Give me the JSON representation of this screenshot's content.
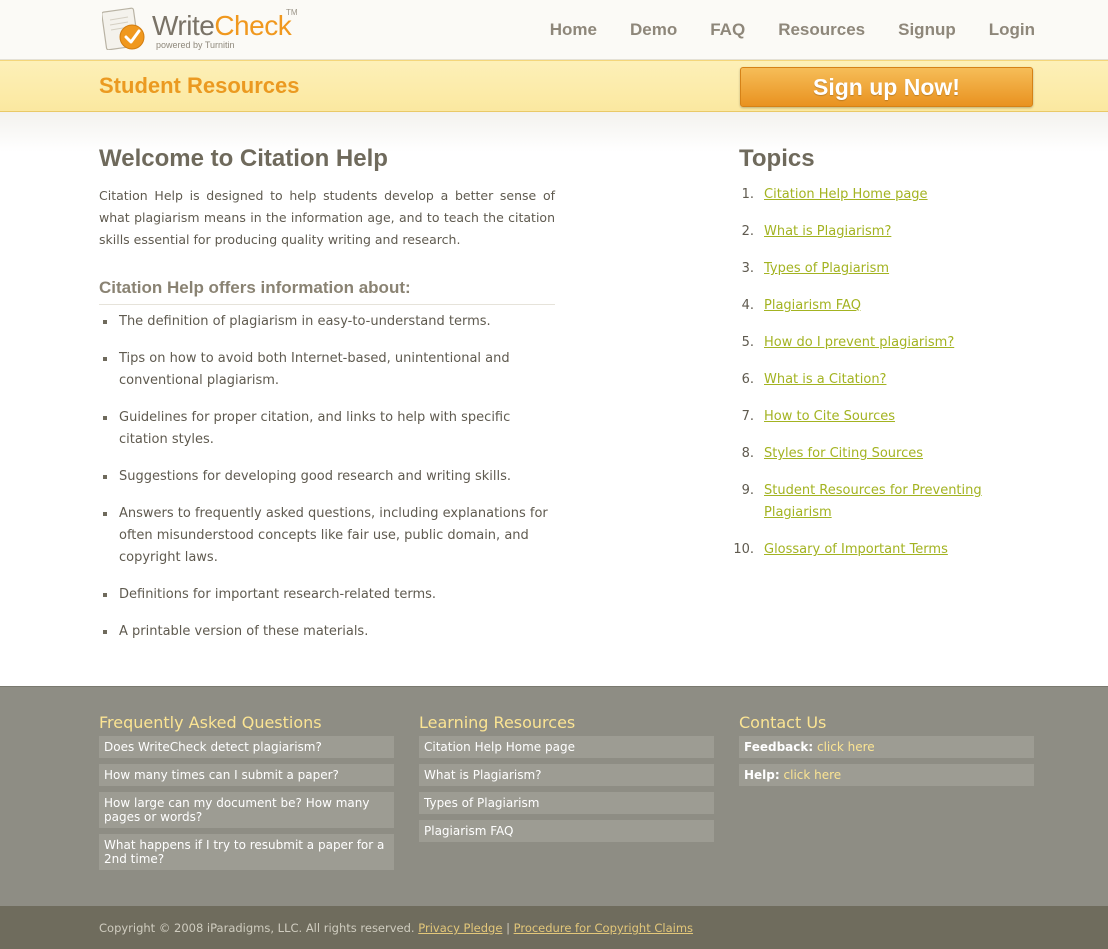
{
  "header": {
    "logo": {
      "word_a": "Write",
      "word_b": "Check",
      "tm": "TM",
      "tagline": "powered by Turnitin"
    },
    "nav": [
      "Home",
      "Demo",
      "FAQ",
      "Resources",
      "Signup",
      "Login"
    ]
  },
  "banner": {
    "title": "Student Resources",
    "signup_label": "Sign up Now!"
  },
  "main": {
    "title": "Welcome to Citation Help",
    "intro": "Citation Help is designed to help students develop a better sense of what plagiarism means in the information age, and to teach the citation skills essential for producing quality writing and research.",
    "subtitle": "Citation Help offers information about:",
    "bullets": [
      "The definition of plagiarism in easy-to-understand terms.",
      "Tips on how to avoid both Internet-based, unintentional and conventional plagiarism.",
      "Guidelines for proper citation, and links to help with specific citation styles.",
      "Suggestions for developing good research and writing skills.",
      "Answers to frequently asked questions, including explanations for often misunderstood concepts like fair use, public domain, and copyright laws.",
      "Definitions for important research-related terms.",
      "A printable version of these materials."
    ]
  },
  "topics": {
    "title": "Topics",
    "items": [
      {
        "num": "1.",
        "label": "Citation Help Home page"
      },
      {
        "num": "2.",
        "label": "What is Plagiarism?"
      },
      {
        "num": "3.",
        "label": "Types of Plagiarism"
      },
      {
        "num": "4.",
        "label": "Plagiarism FAQ"
      },
      {
        "num": "5.",
        "label": "How do I prevent plagiarism?"
      },
      {
        "num": "6.",
        "label": "What is a Citation?"
      },
      {
        "num": "7.",
        "label": "How to Cite Sources"
      },
      {
        "num": "8.",
        "label": "Styles for Citing Sources"
      },
      {
        "num": "9.",
        "label": "Student Resources for Preventing Plagiarism"
      },
      {
        "num": "10.",
        "label": "Glossary of Important Terms"
      }
    ]
  },
  "footer": {
    "faq": {
      "title": "Frequently Asked Questions",
      "items": [
        "Does WriteCheck detect plagiarism?",
        "How many times can I submit a paper?",
        "How large can my document be? How many pages or words?",
        "What happens if I try to resubmit a paper for a 2nd time?"
      ]
    },
    "learning": {
      "title": "Learning Resources",
      "items": [
        "Citation Help Home page",
        "What is Plagiarism?",
        "Types of Plagiarism",
        "Plagiarism FAQ"
      ]
    },
    "contact": {
      "title": "Contact Us",
      "feedback_label": "Feedback:",
      "feedback_link": "click here",
      "help_label": "Help:",
      "help_link": "click here"
    },
    "copyright": {
      "text": "Copyright © 2008 iParadigms, LLC. All rights reserved.",
      "privacy": "Privacy Pledge",
      "separator": "|",
      "procedure": "Procedure for Copyright Claims"
    }
  },
  "colors": {
    "accent_orange": "#eb9a21",
    "link_green": "#a3b321",
    "footer_bg": "#8e8d84",
    "footer_heading": "#fbe493"
  }
}
